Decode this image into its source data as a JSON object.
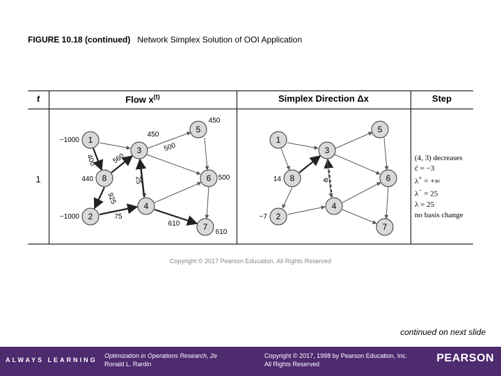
{
  "caption": {
    "fignum": "FIGURE 10.18 (continued)",
    "title": "Network Simplex Solution of OOI Application"
  },
  "headers": {
    "t": "t",
    "flow_pre": "Flow x",
    "flow_sup": "(t)",
    "dir_pre": "Simplex Direction ",
    "dir_delta": "Δx",
    "step": "Step"
  },
  "t_value": "1",
  "flow": {
    "supplies": {
      "n1": "−1000",
      "n2": "−1000",
      "n5": "450",
      "n6": "500",
      "n7": "610",
      "n8": "440"
    },
    "edges": {
      "e18": "400",
      "e83": "560",
      "e82": "925",
      "e13": "450",
      "e35": "500",
      "e24": "75",
      "e47": "610",
      "e43": "25"
    }
  },
  "dir": {
    "supplies": {
      "n2": "−7",
      "n8": "14"
    },
    "label_43": "φ"
  },
  "step_lines": {
    "l1": "(4, 3) decreases",
    "l2": "c̄ = −3",
    "l3_lhs": "λ",
    "l3_sup": "+",
    "l3_rhs": " = +∞",
    "l4_lhs": "λ",
    "l4_sup": "−",
    "l4_rhs": " = 25",
    "l5": "λ = 25",
    "l6": "no basis change"
  },
  "copytext": "Copyright © 2017 Pearson Education, All Rights Reserved",
  "continued": "continued on next slide",
  "footer": {
    "always": "ALWAYS LEARNING",
    "book_title": "Optimization in Operations Research",
    "book_ed": ", 2e",
    "author": "Ronald L. Rardin",
    "copyright": "Copyright © 2017, 1998 by Pearson Education, Inc.",
    "rights": "All Rights Reserved",
    "brand": "PEARSON"
  },
  "nodes": [
    "1",
    "2",
    "3",
    "4",
    "5",
    "6",
    "7",
    "8"
  ]
}
